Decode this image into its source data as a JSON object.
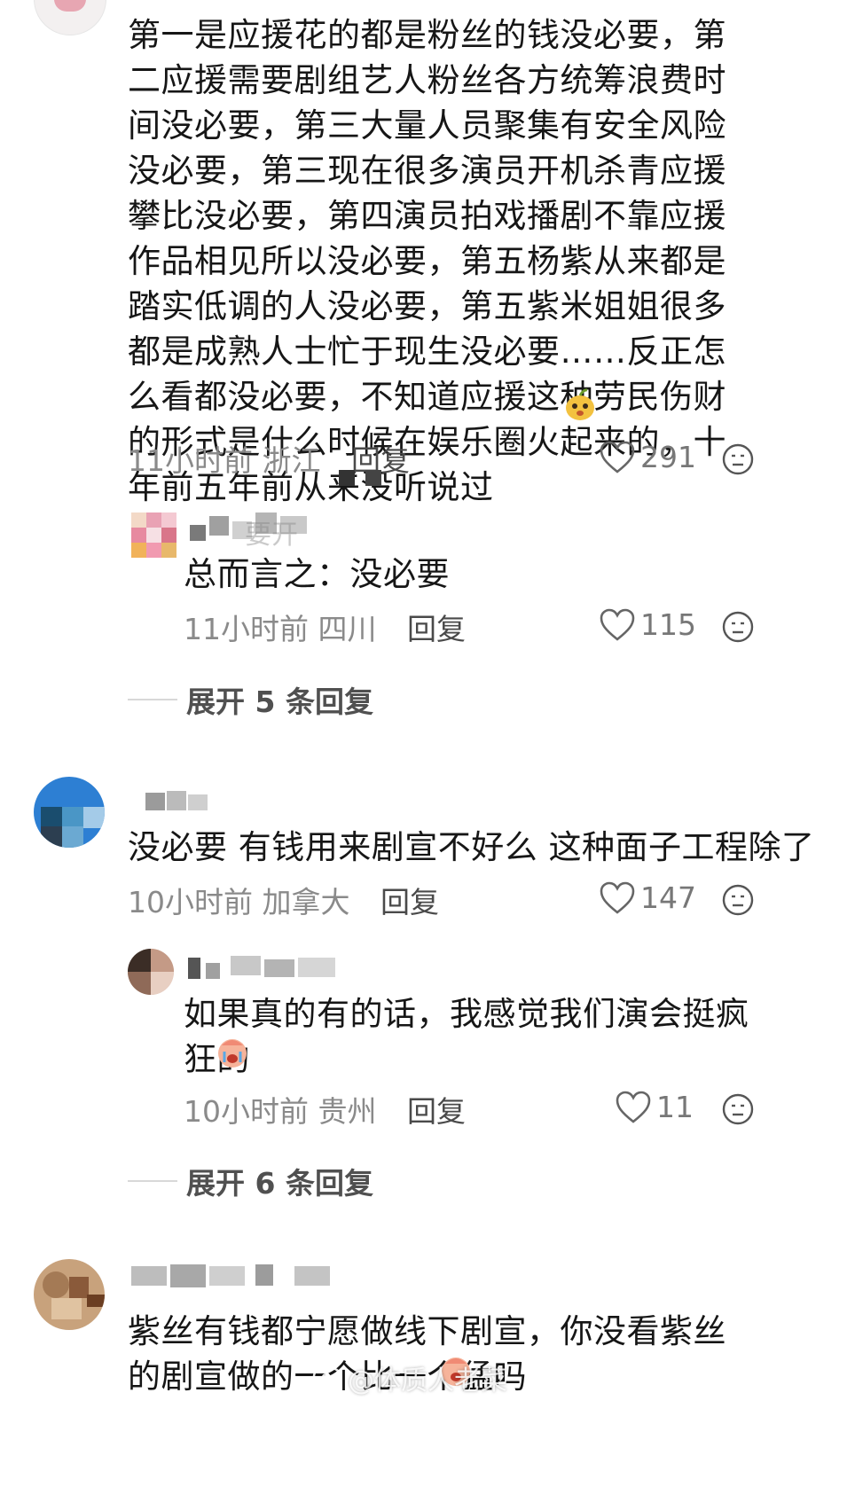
{
  "comments": [
    {
      "text": "第一是应援花的都是粉丝的钱没必要，第二应援需要剧组艺人粉丝各方统筹浪费时间没必要，第三大量人员聚集有安全风险没必要，第三现在很多演员开机杀青应援攀比没必要，第四演员拍戏播剧不靠应援作品相见所以没必要，第五杨紫从来都是踏实低调的人没必要，第五紫米姐姐很多都是成熟人士忙于现生没必要……反正怎么看都没必要，不知道应援这种劳民伤财的形式是什么时候在娱乐圈火起来的，十年前五年前从来没听说过",
      "time": "11小时前",
      "location": "浙江",
      "reply": "回复",
      "likes": "291",
      "sub": {
        "username": "要开",
        "text": "总而言之：没必要",
        "time": "11小时前",
        "location": "四川",
        "reply": "回复",
        "likes": "115"
      },
      "expand": "展开 5 条回复"
    },
    {
      "text": "没必要 有钱用来剧宣不好么 这种面子工程除了",
      "time": "10小时前",
      "location": "加拿大",
      "reply": "回复",
      "likes": "147",
      "sub": {
        "text": "如果真的有的话，我感觉我们演会挺疯狂的",
        "time": "10小时前",
        "location": "贵州",
        "reply": "回复",
        "likes": "11"
      },
      "expand": "展开 6 条回复"
    },
    {
      "text": "紫丝有钱都宁愿做线下剧宣，你没看紫丝的剧宣做的一个比一个猛吗"
    }
  ],
  "watermark": "@体质人老菜",
  "colors": {
    "text": "#161616",
    "meta": "#8a8a8a",
    "divider": "#d8d8d8"
  },
  "icons": [
    "heart-icon",
    "dislike-face-icon",
    "pear-emoji-icon",
    "crying-face-emoji-icon",
    "weibo-logo-icon"
  ]
}
